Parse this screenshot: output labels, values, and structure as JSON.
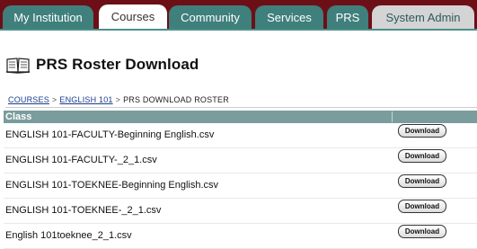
{
  "tabs": [
    {
      "label": "My Institution"
    },
    {
      "label": "Courses"
    },
    {
      "label": "Community"
    },
    {
      "label": "Services"
    },
    {
      "label": "PRS"
    },
    {
      "label": "System Admin"
    }
  ],
  "active_tab": "Courses",
  "page": {
    "title": "PRS Roster Download",
    "title_icon": "book-icon"
  },
  "breadcrumb": {
    "items": [
      "COURSES",
      "ENGLISH 101"
    ],
    "separator": ">",
    "current": "PRS DOWNLOAD ROSTER"
  },
  "table": {
    "column_header": "Class",
    "download_label": "Download",
    "rows": [
      {
        "name": "ENGLISH 101-FACULTY-Beginning English.csv"
      },
      {
        "name": "ENGLISH 101-FACULTY-_2_1.csv"
      },
      {
        "name": "ENGLISH 101-TOEKNEE-Beginning English.csv"
      },
      {
        "name": "ENGLISH 101-TOEKNEE-_2_1.csv"
      },
      {
        "name": "English 101toeknee_2_1.csv"
      }
    ]
  },
  "colors": {
    "tabbar_bg": "#6d0f17",
    "tab_teal": "#3f7f7c",
    "header_teal": "#7a9c9c",
    "link_blue": "#1a3c8c"
  }
}
